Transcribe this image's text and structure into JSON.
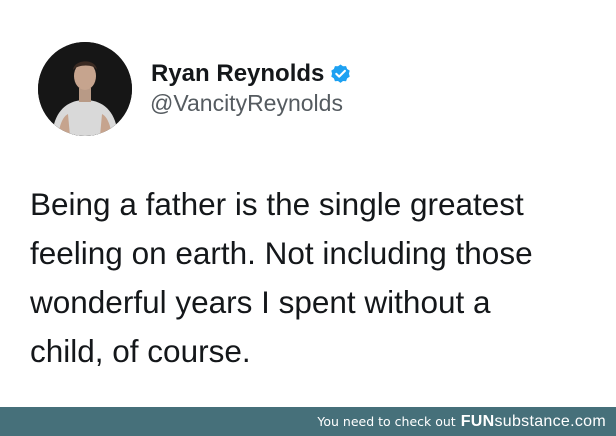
{
  "tweet": {
    "author_name": "Ryan Reynolds",
    "handle": "@VancityReynolds",
    "verified_icon": "verified-badge-icon",
    "text_lines": [
      "Being a father is the single greatest",
      "feeling on earth. Not including those",
      "wonderful years I spent without a",
      "child, of course."
    ]
  },
  "footer": {
    "prefix": "You need to check out",
    "brand_bold": "FUN",
    "brand_light": "substance.com"
  },
  "colors": {
    "text": "#14171a",
    "handle": "#555b60",
    "verified": "#1da1f2",
    "footer_bg": "#46707a"
  }
}
